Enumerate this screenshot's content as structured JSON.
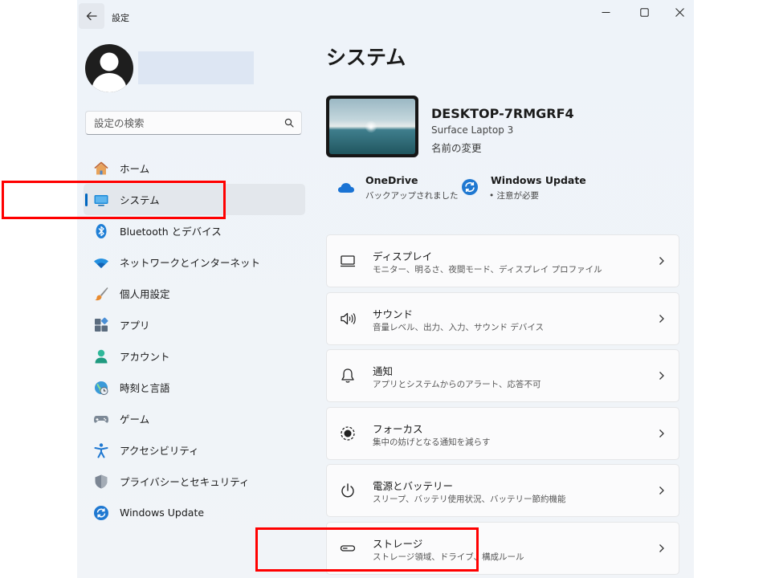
{
  "window": {
    "title": "設定",
    "back_icon": "back-arrow-icon",
    "controls": [
      "minimize-icon",
      "maximize-icon",
      "close-icon"
    ]
  },
  "search": {
    "placeholder": "設定の検索"
  },
  "sidebar": {
    "items": [
      {
        "label": "ホーム",
        "icon": "home-icon"
      },
      {
        "label": "システム",
        "icon": "system-icon",
        "selected": true
      },
      {
        "label": "Bluetooth とデバイス",
        "icon": "bluetooth-icon"
      },
      {
        "label": "ネットワークとインターネット",
        "icon": "wifi-icon"
      },
      {
        "label": "個人用設定",
        "icon": "brush-icon"
      },
      {
        "label": "アプリ",
        "icon": "apps-icon"
      },
      {
        "label": "アカウント",
        "icon": "account-icon"
      },
      {
        "label": "時刻と言語",
        "icon": "time-language-icon"
      },
      {
        "label": "ゲーム",
        "icon": "gamepad-icon"
      },
      {
        "label": "アクセシビリティ",
        "icon": "accessibility-icon"
      },
      {
        "label": "プライバシーとセキュリティ",
        "icon": "shield-icon"
      },
      {
        "label": "Windows Update",
        "icon": "windows-update-icon"
      }
    ]
  },
  "main": {
    "title": "システム",
    "device": {
      "name": "DESKTOP-7RMGRF4",
      "model": "Surface Laptop 3",
      "rename": "名前の変更"
    },
    "status": [
      {
        "title": "OneDrive",
        "subtitle": "バックアップされました",
        "icon": "onedrive-icon"
      },
      {
        "title": "Windows Update",
        "subtitle": "• 注意が必要",
        "icon": "windows-update-icon"
      }
    ],
    "cards": [
      {
        "title": "ディスプレイ",
        "desc": "モニター、明るさ、夜間モード、ディスプレイ プロファイル",
        "icon": "display-icon"
      },
      {
        "title": "サウンド",
        "desc": "音量レベル、出力、入力、サウンド デバイス",
        "icon": "speaker-icon"
      },
      {
        "title": "通知",
        "desc": "アプリとシステムからのアラート、応答不可",
        "icon": "bell-icon"
      },
      {
        "title": "フォーカス",
        "desc": "集中の妨げとなる通知を減らす",
        "icon": "focus-icon"
      },
      {
        "title": "電源とバッテリー",
        "desc": "スリープ、バッテリ使用状況、バッテリー節約機能",
        "icon": "power-icon"
      },
      {
        "title": "ストレージ",
        "desc": "ストレージ領域、ドライブ、構成ルール",
        "icon": "storage-icon"
      }
    ]
  },
  "colors": {
    "accent": "#0067c0",
    "highlight": "#ff0000"
  }
}
